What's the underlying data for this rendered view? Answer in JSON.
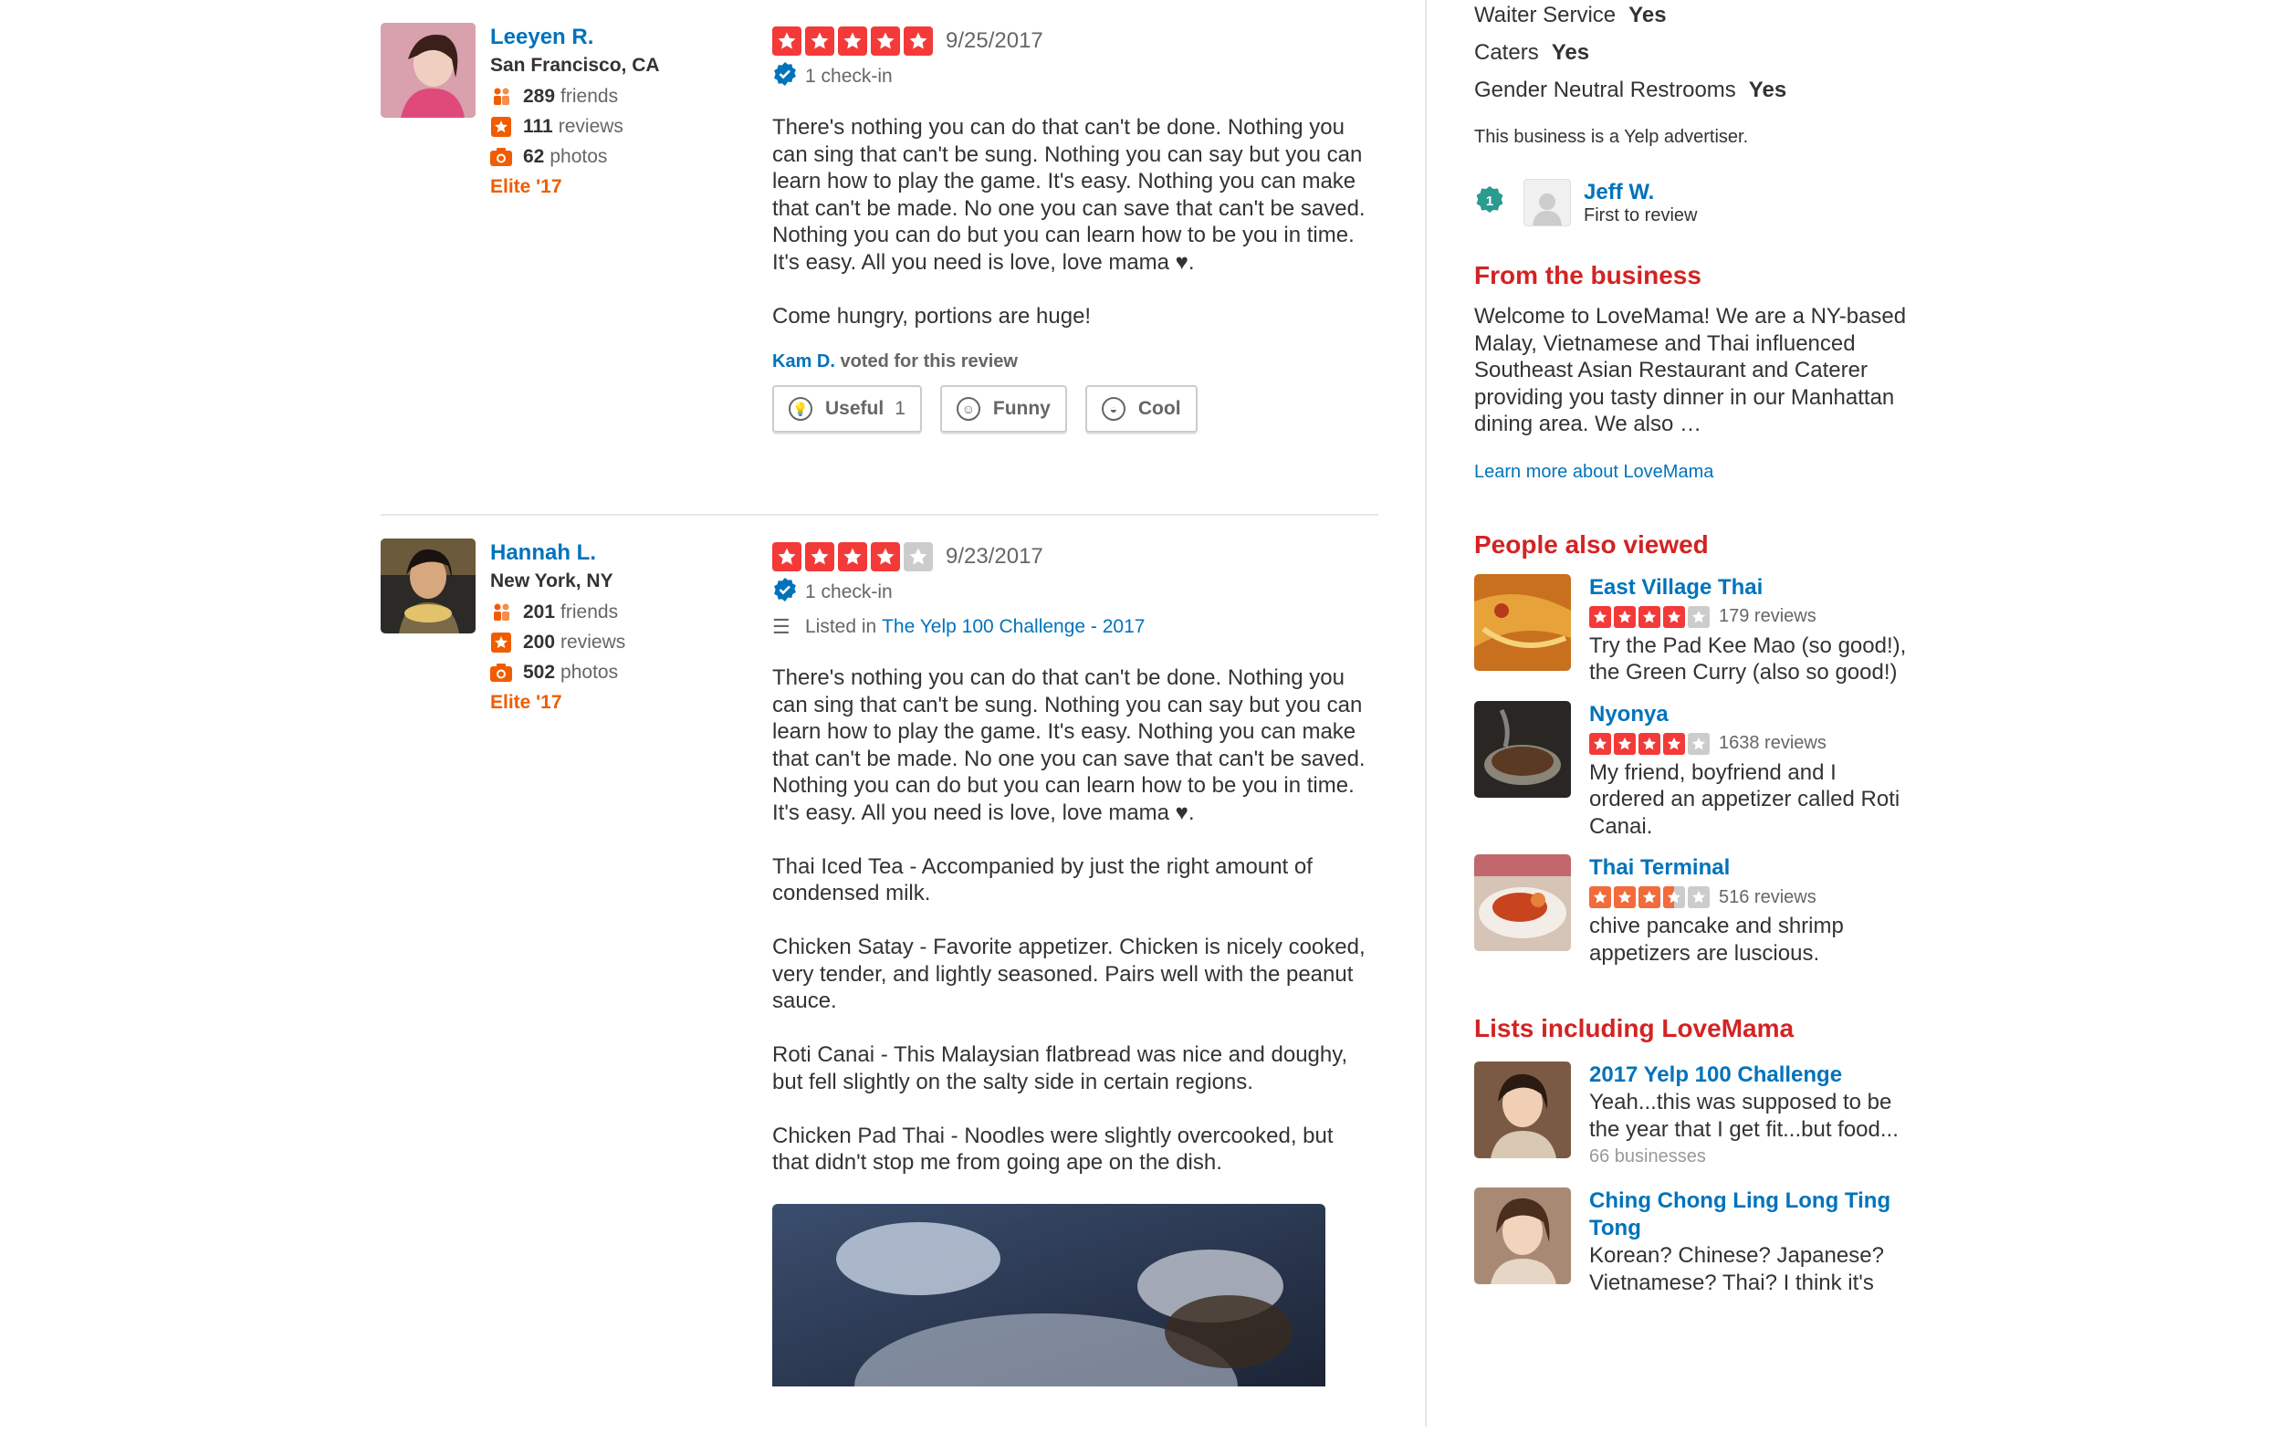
{
  "reviews": [
    {
      "user": {
        "name": "Leeyen R.",
        "location": "San Francisco, CA",
        "friends": "289",
        "friends_label": "friends",
        "reviews": "111",
        "reviews_label": "reviews",
        "photos": "62",
        "photos_label": "photos",
        "elite": "Elite '17"
      },
      "rating": 5,
      "date": "9/25/2017",
      "checkin": "1 check-in",
      "text": "There's nothing you can do that can't be done. Nothing you can sing that can't be sung. Nothing you can say but you can learn how to play the game. It's easy. Nothing you can make that can't be made. No one you can save that can't be saved. Nothing you can do but you can learn how to be you in time. It's easy. All you need is love, love mama ♥.\n\nCome hungry, portions are huge!",
      "voter": "Kam D.",
      "voter_suffix": " voted for this review",
      "buttons": {
        "useful": "Useful",
        "useful_count": "1",
        "funny": "Funny",
        "cool": "Cool"
      }
    },
    {
      "user": {
        "name": "Hannah L.",
        "location": "New York, NY",
        "friends": "201",
        "friends_label": "friends",
        "reviews": "200",
        "reviews_label": "reviews",
        "photos": "502",
        "photos_label": "photos",
        "elite": "Elite '17"
      },
      "rating": 4,
      "date": "9/23/2017",
      "checkin": "1 check-in",
      "listed_prefix": "Listed in ",
      "listed_link": "The Yelp 100 Challenge - 2017",
      "text": "There's nothing you can do that can't be done. Nothing you can sing that can't be sung. Nothing you can say but you can learn how to play the game. It's easy. Nothing you can make that can't be made. No one you can save that can't be saved. Nothing you can do but you can learn how to be you in time. It's easy. All you need is love, love mama ♥.\n\nThai Iced Tea - Accompanied by just the right amount of condensed milk.\n\nChicken Satay - Favorite appetizer. Chicken is nicely cooked, very tender, and lightly seasoned. Pairs well with the peanut sauce.\n\nRoti Canai - This Malaysian flatbread was nice and doughy, but fell slightly on the salty side in certain regions.\n\nChicken Pad Thai - Noodles were slightly overcooked, but that didn't stop me from going ape on the dish."
    }
  ],
  "sidebar": {
    "attributes": [
      {
        "label": "Waiter Service",
        "value": "Yes"
      },
      {
        "label": "Caters",
        "value": "Yes"
      },
      {
        "label": "Gender Neutral Restrooms",
        "value": "Yes"
      }
    ],
    "advertiser": "This business is a Yelp advertiser.",
    "first_reviewer": {
      "name": "Jeff W.",
      "sub": "First to review",
      "rank": "1"
    },
    "from_business": {
      "title": "From the business",
      "text": "Welcome to LoveMama! We are a NY-based Malay, Vietnamese and Thai influenced Southeast Asian Restaurant and Caterer providing you tasty dinner in our Manhattan dining area. We also …",
      "link": "Learn more about LoveMama"
    },
    "people_also_viewed": {
      "title": "People also viewed",
      "items": [
        {
          "name": "East Village Thai",
          "rating": 4,
          "reviews": "179 reviews",
          "desc": "Try the Pad Kee Mao (so good!), the Green Curry (also so good!)"
        },
        {
          "name": "Nyonya",
          "rating": 4,
          "reviews": "1638 reviews",
          "desc": "My friend, boyfriend and I ordered an appetizer called Roti Canai."
        },
        {
          "name": "Thai Terminal",
          "rating": 3.5,
          "reviews": "516 reviews",
          "desc": "chive pancake and shrimp appetizers are luscious."
        }
      ]
    },
    "lists": {
      "title": "Lists including LoveMama",
      "items": [
        {
          "name": "2017 Yelp 100 Challenge",
          "desc": "Yeah...this was supposed to be the year that I get fit...but food...",
          "count": "66 businesses"
        },
        {
          "name": "Ching Chong Ling Long Ting Tong",
          "desc": "Korean? Chinese? Japanese? Vietnamese? Thai? I think it's"
        }
      ]
    }
  },
  "colors": {
    "link": "#0073bb",
    "star_red": "#f43939",
    "star_orange": "#f26b3a",
    "heading_red": "#d32323",
    "elite_orange": "#f15c00"
  }
}
